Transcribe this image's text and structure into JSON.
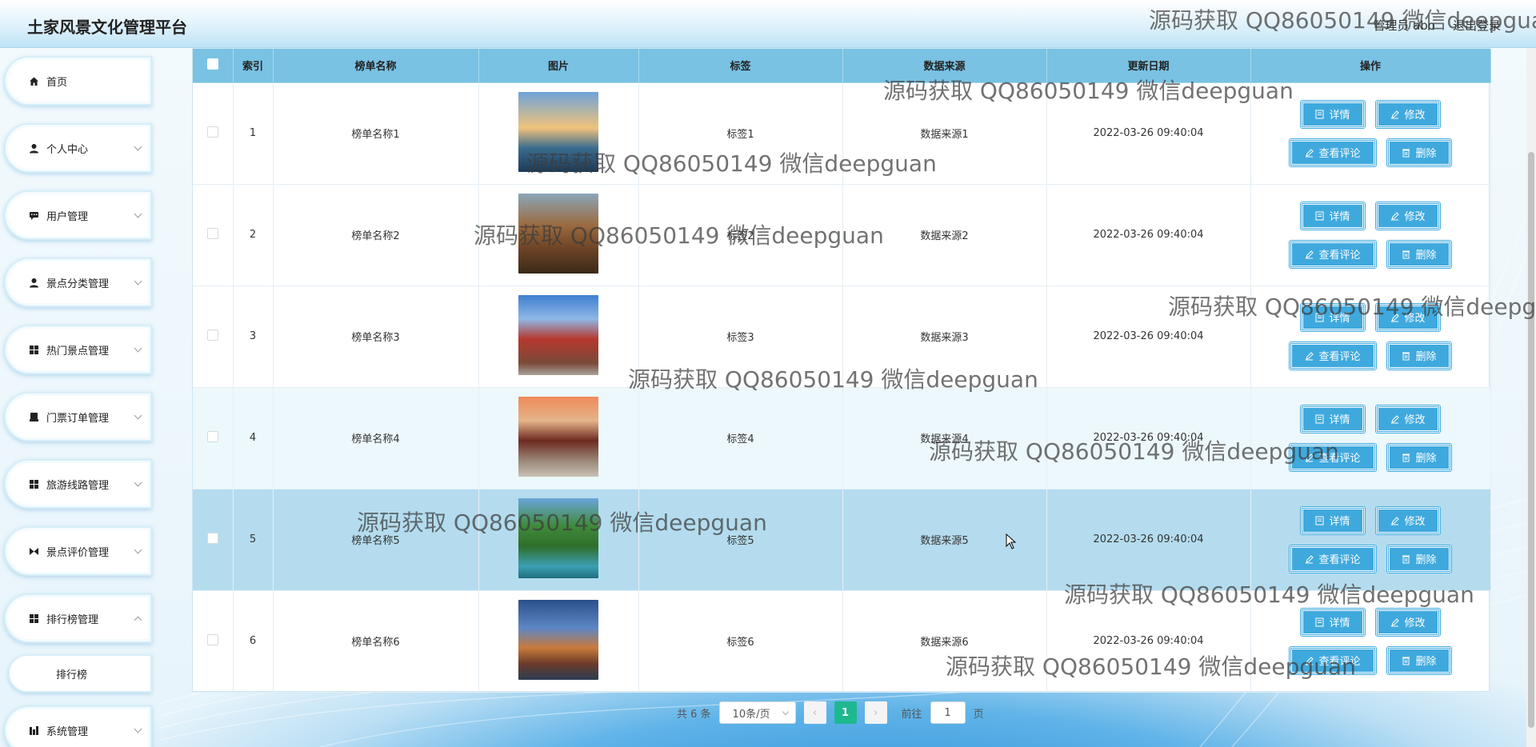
{
  "app": {
    "title": "土家风景文化管理平台"
  },
  "header": {
    "user_label": "管理员 abo",
    "logout_label": "退出登录"
  },
  "sidebar": {
    "items": [
      {
        "label": "首页",
        "icon": "home-icon"
      },
      {
        "label": "个人中心",
        "icon": "user-icon"
      },
      {
        "label": "用户管理",
        "icon": "chat-icon"
      },
      {
        "label": "景点分类管理",
        "icon": "user-icon"
      },
      {
        "label": "热门景点管理",
        "icon": "grid-icon"
      },
      {
        "label": "门票订单管理",
        "icon": "ticket-icon"
      },
      {
        "label": "旅游线路管理",
        "icon": "grid-icon"
      },
      {
        "label": "景点评价管理",
        "icon": "butterfly-icon"
      },
      {
        "label": "排行榜管理",
        "icon": "grid-icon"
      },
      {
        "label": "系统管理",
        "icon": "chart-icon"
      }
    ],
    "submenu": {
      "label": "排行榜"
    }
  },
  "table": {
    "columns": [
      "索引",
      "榜单名称",
      "图片",
      "标签",
      "数据来源",
      "更新日期",
      "操作"
    ],
    "rows": [
      {
        "index": "1",
        "name": "榜单名称1",
        "tag": "标签1",
        "source": "数据来源1",
        "date": "2022-03-26 09:40:04"
      },
      {
        "index": "2",
        "name": "榜单名称2",
        "tag": "标签2",
        "source": "数据来源2",
        "date": "2022-03-26 09:40:04"
      },
      {
        "index": "3",
        "name": "榜单名称3",
        "tag": "标签3",
        "source": "数据来源3",
        "date": "2022-03-26 09:40:04"
      },
      {
        "index": "4",
        "name": "榜单名称4",
        "tag": "标签4",
        "source": "数据来源4",
        "date": "2022-03-26 09:40:04"
      },
      {
        "index": "5",
        "name": "榜单名称5",
        "tag": "标签5",
        "source": "数据来源5",
        "date": "2022-03-26 09:40:04"
      },
      {
        "index": "6",
        "name": "榜单名称6",
        "tag": "标签6",
        "source": "数据来源6",
        "date": "2022-03-26 09:40:04"
      }
    ],
    "actions": {
      "detail": "详情",
      "edit": "修改",
      "comments": "查看评论",
      "delete": "删除"
    }
  },
  "pagination": {
    "total": "共 6 条",
    "page_size": "10条/页",
    "current_page": "1",
    "goto_label": "前往",
    "goto_value": "1",
    "page_suffix": "页"
  },
  "watermark": {
    "text": "源码获取 QQ86050149 微信deepguan"
  },
  "colors": {
    "header_bg": "#79c2e3",
    "button": "#3fa9de",
    "active_page": "#1eb88f"
  }
}
